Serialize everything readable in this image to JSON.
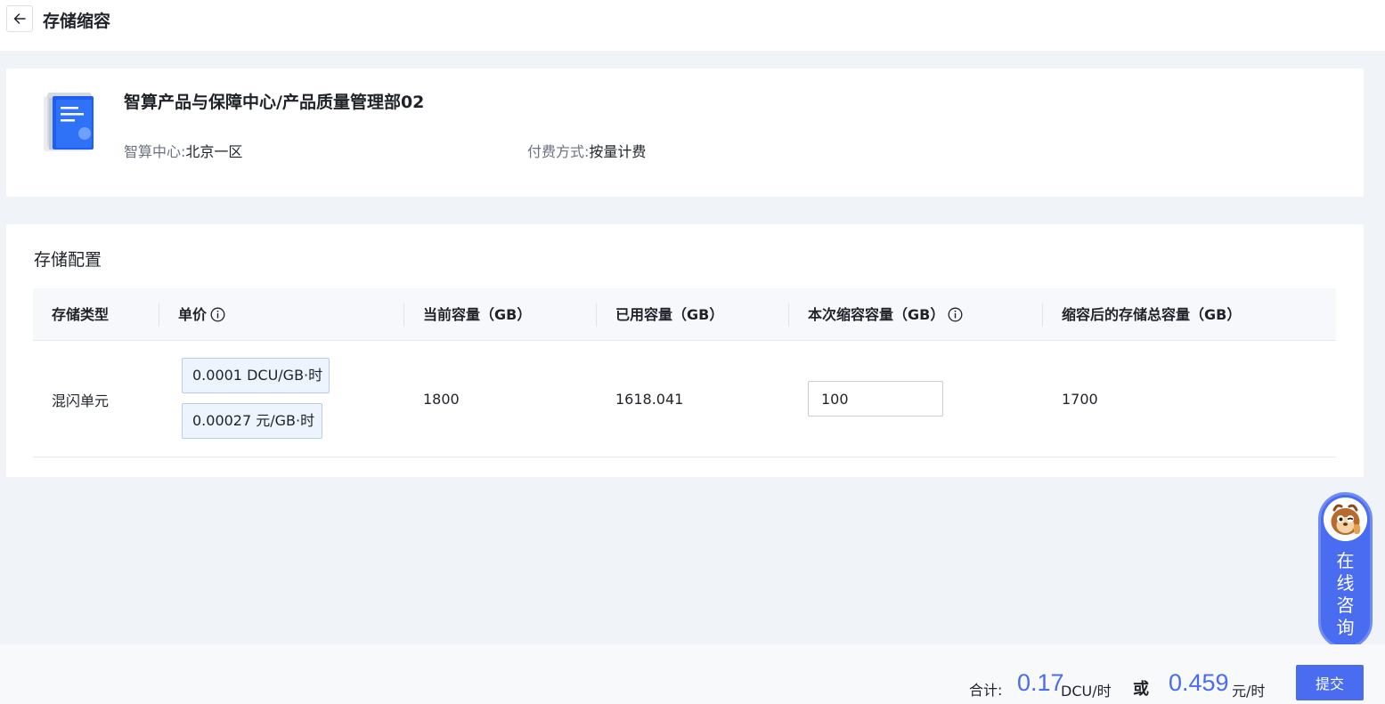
{
  "header": {
    "title": "存储缩容",
    "back_icon": "arrow-left-icon"
  },
  "product": {
    "icon": "storage-product-icon",
    "name": "智算产品与保障中心/产品质量管理部02",
    "region_label": "智算中心:",
    "region_value": "北京一区",
    "billing_label": "付费方式:",
    "billing_value": "按量计费"
  },
  "config": {
    "title": "存储配置",
    "columns": [
      "存储类型",
      "单价",
      "当前容量（GB）",
      "已用容量（GB）",
      "本次缩容容量（GB）",
      "缩容后的存储总容量（GB）"
    ],
    "row": {
      "storage_type": "混闪单元",
      "price_dcu": "0.0001 DCU/GB·时",
      "price_yuan": "0.00027 元/GB·时",
      "current_capacity": "1800",
      "used_capacity": "1618.041",
      "shrink_capacity": "100",
      "after_capacity": "1700"
    }
  },
  "consult": {
    "label": "在线咨询"
  },
  "footer": {
    "total_label": "合计:",
    "amount_dcu": "0.17",
    "unit_dcu": "DCU/时",
    "or": "或",
    "amount_yuan": "0.459",
    "unit_yuan": "元/时",
    "submit": "提交"
  },
  "colors": {
    "primary": "#4a6cf0",
    "background": "#f0f3f8",
    "price_box_bg": "#eef4fd"
  }
}
